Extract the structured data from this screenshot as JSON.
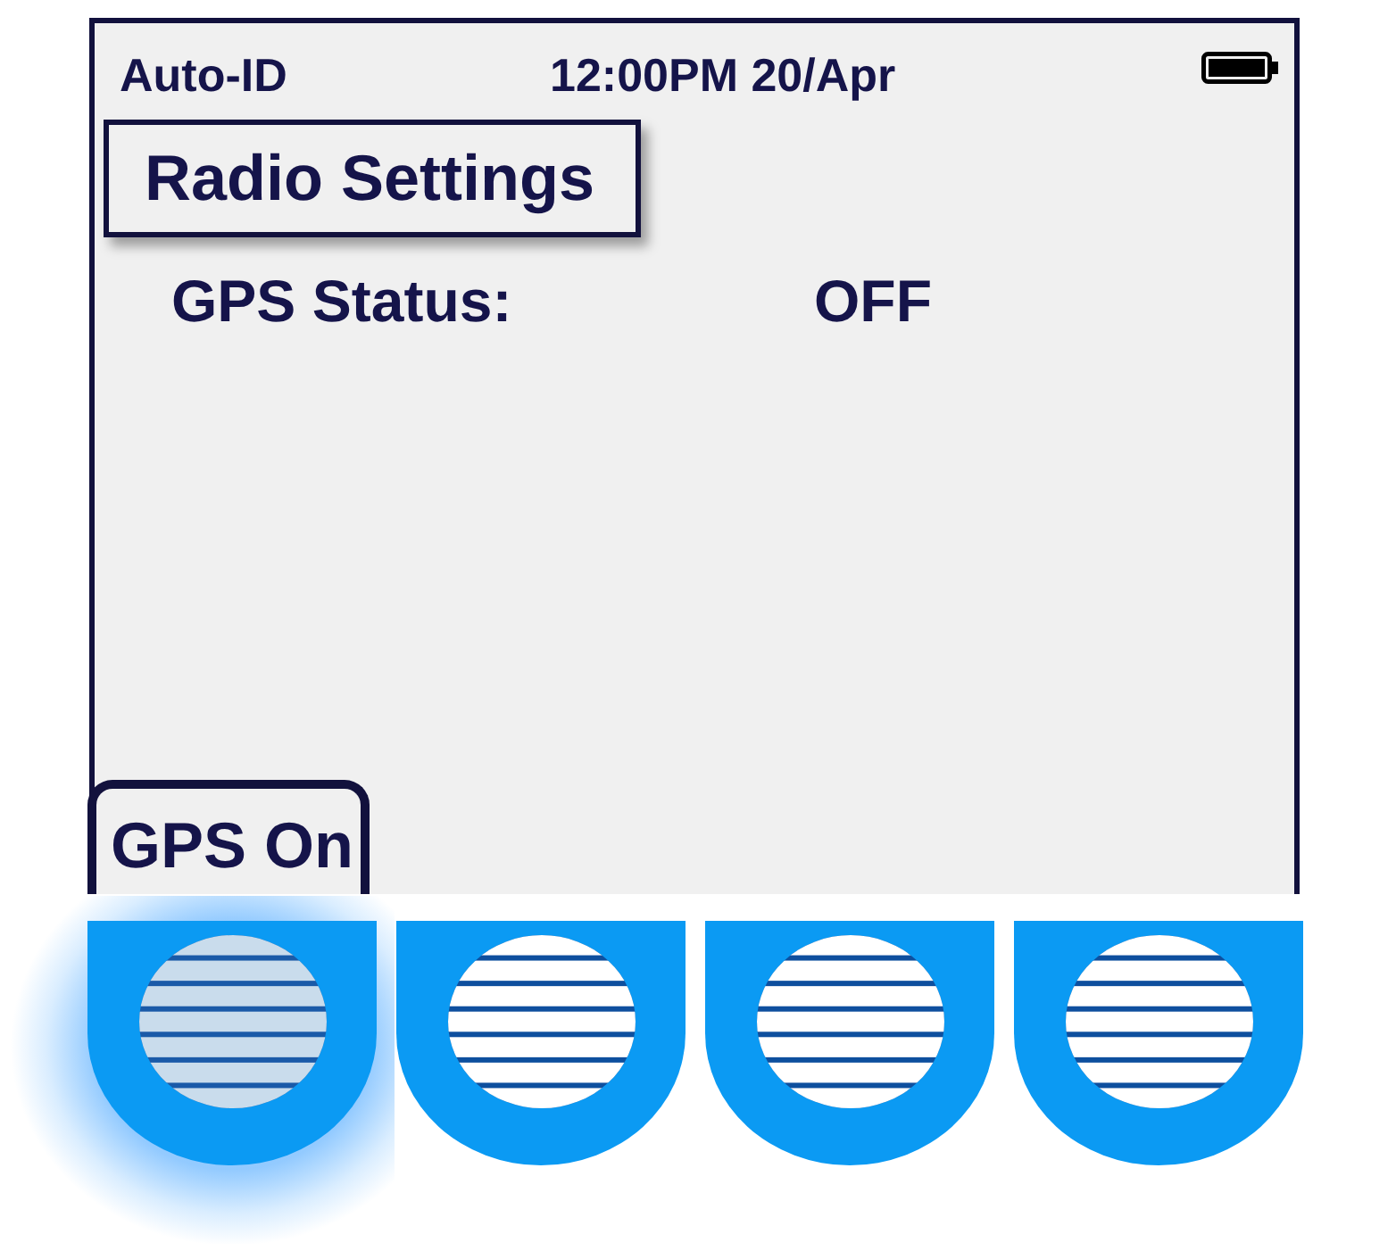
{
  "screen": {
    "status_bar": {
      "left": "Auto-ID",
      "clock": "12:00PM 20/Apr"
    },
    "title": "Radio Settings",
    "fields": [
      {
        "label": "GPS Status:",
        "value": "OFF"
      }
    ],
    "softkeys": [
      {
        "label": "GPS On"
      }
    ]
  },
  "keypad": {
    "buttons": [
      {
        "pressed": true
      },
      {
        "pressed": false
      },
      {
        "pressed": false
      },
      {
        "pressed": false
      }
    ]
  }
}
